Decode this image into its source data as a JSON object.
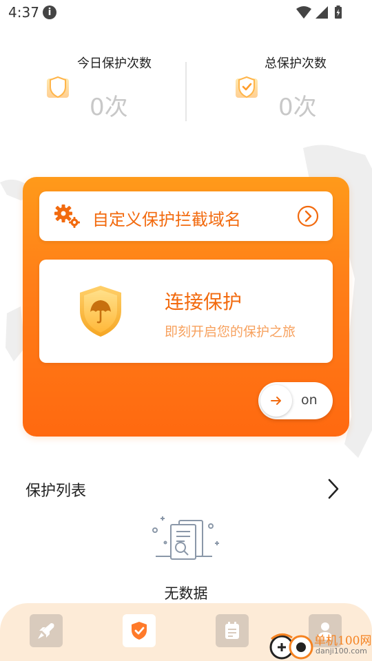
{
  "status_bar": {
    "time": "4:37",
    "info_glyph": "i",
    "icons": [
      "info-icon",
      "wifi-icon",
      "signal-icon",
      "battery-charging-icon"
    ]
  },
  "stats": {
    "today": {
      "label": "今日保护次数",
      "value": "0次",
      "icon": "shield-outline-icon"
    },
    "total": {
      "label": "总保护次数",
      "value": "0次",
      "icon": "shield-check-icon"
    }
  },
  "custom_domain": {
    "label": "自定义保护拦截域名",
    "icons": [
      "gear-icon",
      "arrow-circle-right-icon"
    ]
  },
  "connect": {
    "title": "连接保护",
    "subtitle": "即刻开启您的保护之旅",
    "icon": "umbrella-shield-icon"
  },
  "toggle": {
    "label": "on",
    "icon": "arrow-right-icon"
  },
  "protection_list": {
    "title": "保护列表",
    "icon": "chevron-right-icon"
  },
  "empty_state": {
    "text": "无数据",
    "icon": "document-search-icon"
  },
  "bottom_nav": {
    "items": [
      "rocket-icon",
      "shield-check-icon",
      "notes-icon",
      "user-icon"
    ],
    "active_index": 1
  },
  "watermark": {
    "brand": "单机100网",
    "url": "danji100.com"
  },
  "colors": {
    "accent": "#ff7f18",
    "accent_text": "#f26a0e",
    "subtitle": "#f7a15e",
    "nav_bg": "#fdebd7"
  }
}
